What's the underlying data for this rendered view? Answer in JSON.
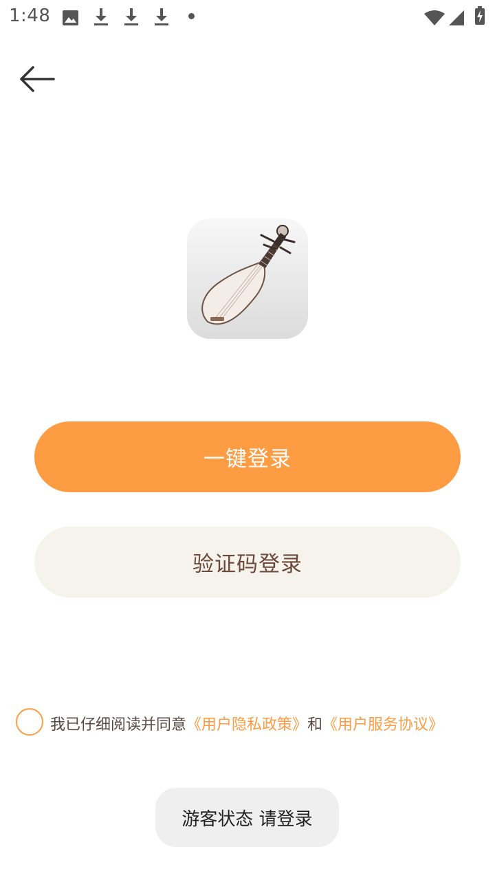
{
  "status_bar": {
    "time": "1:48",
    "icons": [
      "image-icon",
      "download-icon",
      "download-icon",
      "download-icon",
      "notification-dot",
      "wifi-icon",
      "signal-icon",
      "battery-charging-icon"
    ]
  },
  "header": {
    "back_icon": "arrow-left-icon"
  },
  "app": {
    "icon": "pipa-instrument-logo"
  },
  "buttons": {
    "one_click_login": "一键登录",
    "sms_code_login": "验证码登录"
  },
  "agreement": {
    "prefix": "我已仔细阅读并同意",
    "privacy_policy": "《用户隐私政策》",
    "conjunction": "和",
    "service_agreement": "《用户服务协议》"
  },
  "toast": {
    "message": "游客状态 请登录"
  },
  "colors": {
    "accent": "#fd9c42",
    "secondary_button_bg": "#f6f3ec",
    "secondary_button_text": "#6b4a3c",
    "toast_bg": "#efefef"
  }
}
